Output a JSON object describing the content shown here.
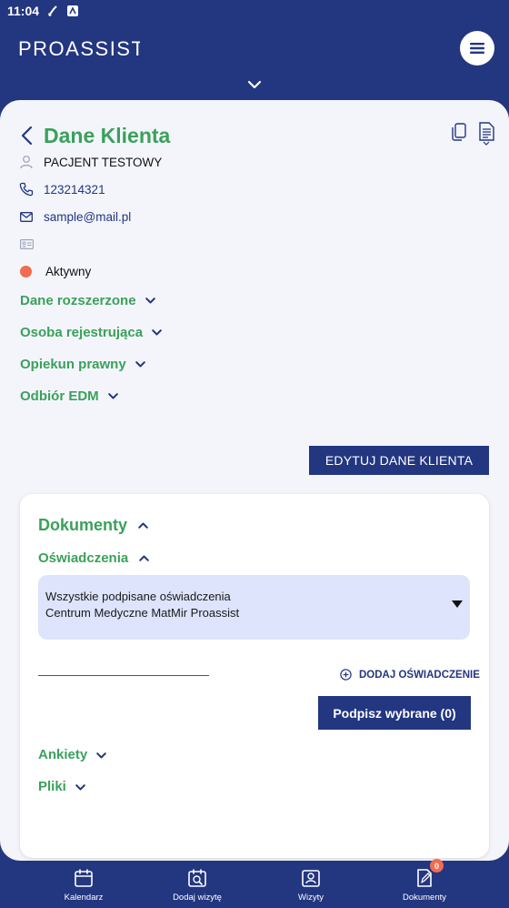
{
  "status_bar": {
    "time": "11:04"
  },
  "brand": {
    "name": "PROASSIST"
  },
  "client": {
    "title": "Dane Klienta",
    "name": "PACJENT TESTOWY",
    "phone": "123214321",
    "email": "sample@mail.pl",
    "id_card": "",
    "status": "Aktywny"
  },
  "sections": [
    {
      "label": "Dane rozszerzone"
    },
    {
      "label": "Osoba rejestrująca"
    },
    {
      "label": "Opiekun prawny"
    },
    {
      "label": "Odbiór EDM"
    }
  ],
  "edit_button": "EDYTUJ DANE KLIENTA",
  "documents": {
    "title": "Dokumenty",
    "declarations": {
      "title": "Oświadczenia",
      "select_line1": "Wszystkie podpisane oświadczenia",
      "select_line2": "Centrum Medyczne MatMir Proassist",
      "add_label": "DODAJ OŚWIADCZENIE",
      "sign_button": "Podpisz wybrane (0)"
    },
    "surveys": "Ankiety",
    "files": "Pliki"
  },
  "bottom_nav": [
    {
      "label": "Kalendarz",
      "icon": "calendar-icon"
    },
    {
      "label": "Dodaj wizytę",
      "icon": "calendar-search-icon"
    },
    {
      "label": "Wizyty",
      "icon": "visits-icon"
    },
    {
      "label": "Dokumenty",
      "icon": "document-edit-icon",
      "badge": "0"
    }
  ],
  "colors": {
    "primary": "#233680",
    "accent": "#3aa15a",
    "status_active": "#f26c4f",
    "background": "#f3f5fb"
  }
}
